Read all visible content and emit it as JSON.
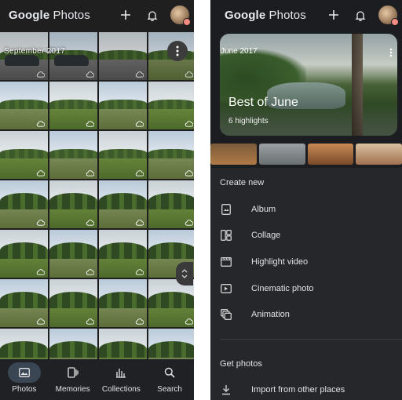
{
  "left_panel": {
    "app_title_prefix": "Google",
    "app_title_suffix": " Photos",
    "date_label": "September 2017",
    "grid_tile_count": 28,
    "nav": [
      {
        "label": "Photos",
        "icon": "photos-icon",
        "active": true
      },
      {
        "label": "Memories",
        "icon": "memories-icon",
        "active": false
      },
      {
        "label": "Collections",
        "icon": "collections-icon",
        "active": false
      },
      {
        "label": "Search",
        "icon": "search-icon",
        "active": false
      }
    ]
  },
  "right_panel": {
    "app_title_prefix": "Google",
    "app_title_suffix": " Photos",
    "memory": {
      "date": "June 2017",
      "title": "Best of June",
      "subtitle": "6 highlights"
    },
    "create_new": {
      "heading": "Create new",
      "items": [
        {
          "label": "Album",
          "icon": "album-icon"
        },
        {
          "label": "Collage",
          "icon": "collage-icon"
        },
        {
          "label": "Highlight video",
          "icon": "highlight-video-icon"
        },
        {
          "label": "Cinematic photo",
          "icon": "cinematic-photo-icon"
        },
        {
          "label": "Animation",
          "icon": "animation-icon"
        }
      ]
    },
    "get_photos": {
      "heading": "Get photos",
      "items": [
        {
          "label": "Import from other places",
          "icon": "import-icon"
        }
      ]
    }
  },
  "colors": {
    "background_dark": "#1f1f1f",
    "sheet_background": "#26272b",
    "active_nav_pill": "#3b4654",
    "text_primary": "#e3e3e3"
  }
}
